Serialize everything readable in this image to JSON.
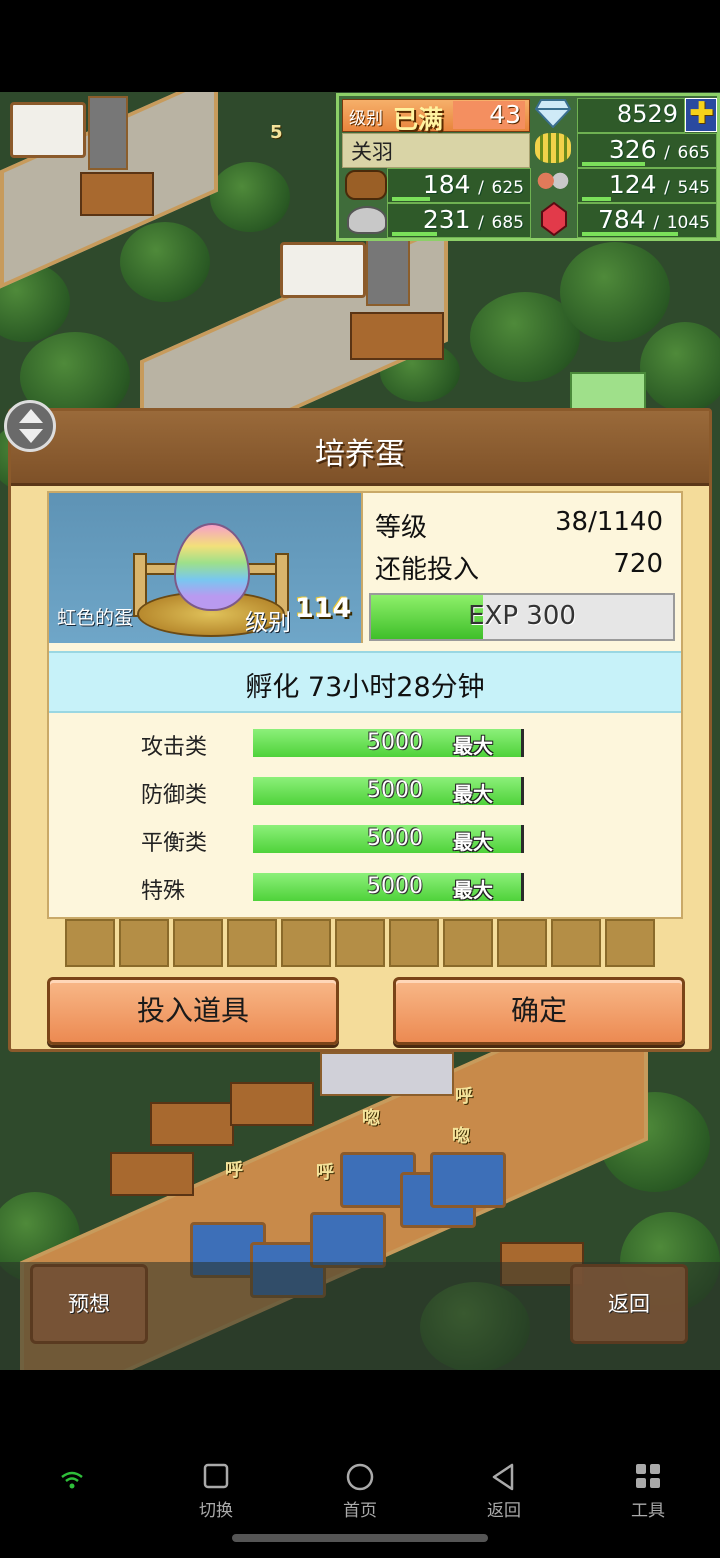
{
  "hud": {
    "level_label": "级别",
    "level_status": "已满",
    "level_value": "43",
    "gems": "8529",
    "player_name": "关羽",
    "food": {
      "current": "326",
      "max": "665",
      "fraction": 0.49
    },
    "wood": {
      "current": "184",
      "max": "625",
      "fraction": 0.29
    },
    "workers": {
      "current": "124",
      "max": "545",
      "fraction": 0.23
    },
    "ore": {
      "current": "231",
      "max": "685",
      "fraction": 0.34
    },
    "crystal": {
      "current": "784",
      "max": "1045",
      "fraction": 0.75
    },
    "sep": "/"
  },
  "map": {
    "marker": "5",
    "snore": "呼",
    "snore2": "唿"
  },
  "dialog": {
    "title": "培养蛋",
    "egg_name": "虹色的蛋",
    "egg_level_label": "级别",
    "egg_level_value": "114",
    "stat1_label": "等级",
    "stat1_value": "38/1140",
    "stat2_label": "还能投入",
    "stat2_value": "720",
    "exp_text": "EXP 300",
    "exp_fraction": 0.37,
    "hatch_text": "孵化 73小时28分钟",
    "attributes": [
      {
        "label": "攻击类",
        "value": "5000",
        "max": "最大"
      },
      {
        "label": "防御类",
        "value": "5000",
        "max": "最大"
      },
      {
        "label": "平衡类",
        "value": "5000",
        "max": "最大"
      },
      {
        "label": "特殊",
        "value": "5000",
        "max": "最大"
      }
    ],
    "btn_items": "投入道具",
    "btn_confirm": "确定"
  },
  "corner": {
    "forecast": "预想",
    "back": "返回"
  },
  "nav": {
    "switch": "切换",
    "home": "首页",
    "back": "返回",
    "tools": "工具"
  }
}
